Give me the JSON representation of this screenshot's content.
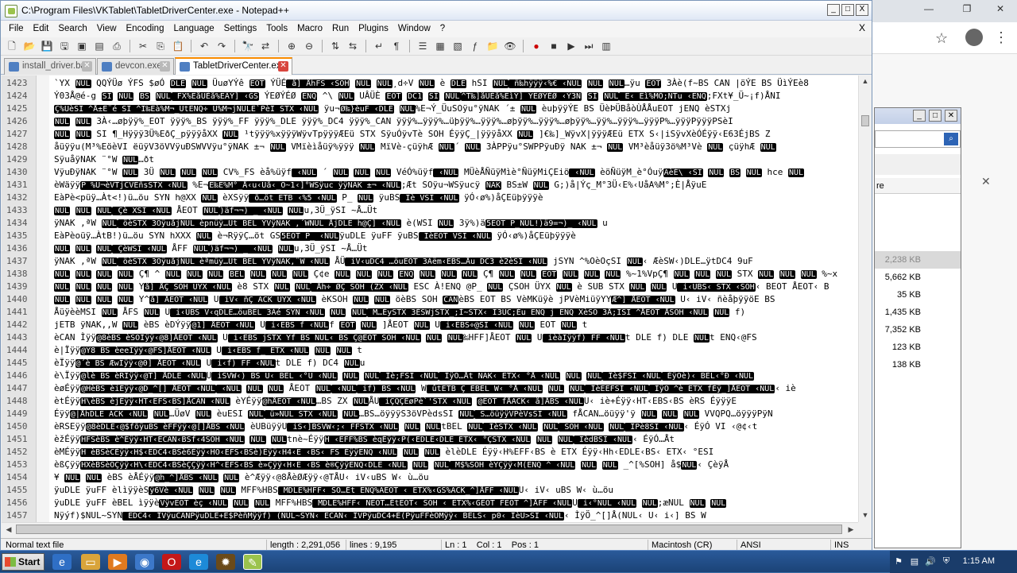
{
  "window": {
    "title": "C:\\Program Files\\VKTablet\\TabletDriverCenter.exe - Notepad++",
    "min_btn": "_",
    "max_btn": "□",
    "close_btn": "X"
  },
  "menubar": {
    "items": [
      "File",
      "Edit",
      "Search",
      "View",
      "Encoding",
      "Language",
      "Settings",
      "Tools",
      "Macro",
      "Run",
      "Plugins",
      "Window",
      "?"
    ],
    "close": "X"
  },
  "tabs": [
    {
      "label": "install_driver.bat",
      "active": false
    },
    {
      "label": "devcon.exe",
      "active": false
    },
    {
      "label": "TabletDriverCenter.exe",
      "active": true
    }
  ],
  "editor": {
    "lines": [
      {
        "num": "1423",
        "text": "`YX ‹NUL› QQÝÜø ÝFS $øÓ ‹DLE› ‹NUL› ÜuøYÝê ‹EOT› ÝÜÉ‹ å] ÅhFS ‹SOH› ‹NUL› ‹NUL›¸d÷V ‹NUL› è ‹DLE› hSI ‹NUL›‹ ñ‰hÿÿÿ‹%€ ‹NUL› ‹NUL› ‹NUL›…ÿu ‹EOT› 3Àè(f~BS CAN |öÝE BS ÜìÝEè8"
      },
      {
        "num": "1424",
        "text": "Ý03Å@é-g ‹SI› ‹NUL› ‹BS› ‹NUL›‹ FX%EåÜÈå%EÂÝ] ‹GS› ÝEØÝÉØ ‹ENQ› ^\\ ‹NUL› UÂÜÈ ‹EOT› ‹DC1› ‹SI› ‹NUL›‹^T‰]åÜÈå%EìÝ] ÝEØÝÉØ ‹Ý3N› ‹SI› ‹NUL›‹ E‹ Eì%MÕ;NTu ‹ENQ›;FXt¥_Ü~¡f)ÅNI"
      },
      {
        "num": "1425",
        "text": "‹Ç%ÜèSI ^Å±E¨é  SI ^I‰Eà%M¬_ÜtENQ÷ Ü%M¬jNULE`PèI STX ‹NUL› ÿu¬‹Ø‰}èuF ‹DLE› ‹NUL›%E¬Ý_ÜuSOÿu°ÿNAK ´± ‹NUL› èuþÿÿÝE BS ÜèÞÜBåòÙÅÅuEOT jENQ èSTXj"
      },
      {
        "num": "1426",
        "text": "‹NUL› ‹NUL› 3À‹…øþÿÿ%_EOT ÿÿÿ%_BS ÿÿÿ%_FF ÿÿÿ%_DLE ÿÿÿ%_DC4 ÿÿÿ%_CAN ÿÿÿ%…ÿÿÿ%…üþÿÿ%…ÿÿÿ%…øþÿÿ%…ÿÿÿ%…øþÿÿ%…ÿÿ%…ÿÿÿ%…ÿÿÿP%…ÿÿÿPÿÿÿPSèI"
      },
      {
        "num": "1427",
        "text": "‹NUL› ‹NUL› SI ¶_Hÿÿÿ3Ü%EðÇ_pÿÿÿåXX ‹NUL› ¹tÿÿÿ%xÿÿÿWÿvTpÿÿÿÆEü STX SÿuÓÿvTè SOH ÉÿÿÇ_|ÿÿÿåXX ‹NUL› ]€‰]_WÿvX|ÿÿÿÆEü ETX S‹|iSÿvXèÓÉÿÿ‹E63ÉjBS Z"
      },
      {
        "num": "1428",
        "text": "åüÿÿu(M³%EöèVI ëüÿV3öVVÿuÐSWVVÿu°ÿNAK ±¬ ‹NUL› VMïèìåüÿ%ÿÿÿ ‹NUL› MïVè-çüÿhÆ ‹NUL›´ ‹NUL› 3ÀPPÿu°SWPPÿuÐÿ NAK ±¬ ‹NUL› VM³èåüÿ3ö%M³Vè ‹NUL› çüÿhÆ ‹NUL›"
      },
      {
        "num": "1429",
        "text": "SÿuåÿNAK ¨°W ‹NUL›…ðt"
      },
      {
        "num": "1430",
        "text": "VÿuÐÿNAK ¨°W ‹NUL› 3Ü ‹NUL› ‹NUL› ‹NUL› CV%_FS èå%üÿf‹ ‹NUL› ´ ‹NUL› ‹NUL› ‹NUL› VéÓ%üÿf‹ ‹NUL› MÜèÅÑüÿMìè°ÑüÿMiÇEiö‹ ‹NUL› èöÑüÿM_è°Óuÿ‹ÃèÉ\\ ‹SI› ‹NUL› ‹BS› ‹NUL› hce ‹NUL›"
      },
      {
        "num": "1431",
        "text": "èWäÿÿ‹P %U¬èVTjCVËñsSTX ‹NUL› %E¬‹E‰E%M°_Å‹u‹Uå‹_Ò~1‹]°WSÿuc ÿÿNAK ±¬ ‹NUL›;Æt SOÿu¬WSÿucÿ ‹NAK› BS±W ‹NUL› G;)å|Ýç_M°3Ü‹E%‹UåA%M°;È|ÅÿuE"
      },
      {
        "num": "1432",
        "text": "EàPè<püÿ…Àt<!)ü…öu SYN h@XX ‹NUL› èXSÿÿ‹ õ…öt ETB ‹%5 ‹NUL› P_ ‹NUL› ÿuBS‹ Ïè VSI ‹NUL› ÿÓ‹ø%)åÇEüþÿÿÿè"
      },
      {
        "num": "1433",
        "text": "‹NUL› ‹NUL› ‹NUL›‹ Çè  XSI ‹NUL› ÅEOT ‹NUL›‹)äf¬¬) _ ‹NUL› ‹NUL›u,3Ü_ÿSI ~Å…Üt"
      },
      {
        "num": "1434",
        "text": "ÿNAK ,ªW ‹NUL›‹ öèSTX 3ÓÿuåjNUL èpnüÿ…Üt BEL ÝVÿNAK ,´WNUL ÅjDLE h@Ç] ‹NUL› è(WSI ‹NUL› 3ÿ%)ä‹5EOT P_NUL!)ä9=¬)_ ‹NUL› u"
      },
      {
        "num": "1435",
        "text": "EàPèoüÿ…ÀtB!)ü…öu SYN hXXX ‹NUL› è¬RÿÿÇ…öt GS‹5EOT P_ ‹NUL›ÿuDLE ÿuFF ÿuBS‹ ÏèEOT VSI ‹NUL› ÿÓ‹ø%)åÇEüþÿÿÿè"
      },
      {
        "num": "1436",
        "text": "‹NUL› ‹NUL› ‹NUL›‹ ÇèWSI ‹NUL› ÅFF ‹NUL›‹)äf¬¬) _ ‹NUL› ‹NUL›u,3Ü_ÿSI ~Å…Üt"
      },
      {
        "num": "1437",
        "text": "ÿNAK ,ªW ‹NUL›‹ öèSTX 3ÓÿuåjNUL èªmüÿ…Üt BEL ÝVÿNAK,¨W ‹NUL› ÅÜ‹ iV‹uDC4 …öuEOT 3Àëm‹EBS…Åu DC3 è2èSI ‹NUL› jSYN ^%OèOçSI ‹NUL›‹ ÆèSW‹)DLE…ÿtDC4 9uF"
      },
      {
        "num": "1438",
        "text": "‹NUL› ‹NUL› ‹NUL› ‹NUL› Ç¶ ^ ‹NUL› ‹NUL› ‹NUL› ‹BEL› ‹NUL› ‹NUL› ‹NUL› Ç¢e ‹NUL› ‹NUL› ‹NUL› ‹ENQ› ‹NUL› ‹NUL› ‹NUL› Ç¶ ‹NUL› ‹NUL› ‹EOT› ‹NUL› ‹NUL› ‹NUL› %~1%VpÇ¶ ‹NUL› ‹NUL› ‹NUL› STX ‹NUL› ‹NUL› ‹NUL› %~x"
      },
      {
        "num": "1439",
        "text": "‹NUL› ‹NUL› ‹NUL› ‹NUL› Y‹å] ÅÇ SOH ÜYX ‹NUL› è8 STX ‹NUL› ‹NUL›‹ Åh÷ ØÇ SOH (ZX ‹NUL› ESC À!ENQ @P_ ‹NUL› ÇSOH ÜYX ‹NUL› è SUB STX ‹NUL› ‹NUL› U‹ i‹UBS‹ STX ‹SOH›‹ BEOT ÅEOT‹ B"
      },
      {
        "num": "1440",
        "text": "‹NUL› ‹NUL› ‹NUL› ‹NUL› Y^‹å] ÅEOT ‹NUL› U‹ iV‹ ñÇ ACK ÜYX ‹NUL› èKSOH ‹NUL› ‹NUL› öèBS SOH ‹CAN›èBS EOT BS VèMKüÿè  jPVèMiüÿYY‹Æ^] ÅEOT ‹NUL› U‹ iV‹ ñèåþÿÿöE BS"
      },
      {
        "num": "1441",
        "text": "ÅüÿèèMSI ‹NUL› ÅFS ‹NUL› U‹ i‹UBS V‹qDLE…öuBEL 3Àé SYN ‹NUL› ‹NUL› ‹NUL›‹ M…ÉySTX 3ÉSWjSTX_;Ì~STX‹ Ï3ÜC;Éu ENQ j ENQ XèSO 3Å;ISI ^ÅEOT ÅSOH ‹NUL› ‹NUL› f)"
      },
      {
        "num": "1442",
        "text": "jETB ÿNAK,,W ‹NUL› èBS èDÝÿÿ‹@1] ÅEOT ‹NUL› U‹ i‹EBS f  ‹NUL›f ‹EOT› ‹NUL› ]ÅEOT ‹NUL› U‹ i‹EBS÷@SI ‹NUL› ‹NUL› EOT ‹NUL› t"
      },
      {
        "num": "1443",
        "text": "èCAN Ìÿÿ‹@8èBS èSOÌÿÿ‹@8]ÅEOT ‹NUL› U‹ i‹EBS jSTX Yf BS NUL‹ BS Ç@EOT SOH ‹NUL› ‹NUL› ‹NUL›‰HFF]ÅEOT ‹NUL› U‹ ièàÏÿÿf) FF ‹NUL›t DLE f) DLE ‹NUL›t ENQ‹@FS"
      },
      {
        "num": "1444",
        "text": "è|Ïÿÿ‹@Ý8 BS èeeÏÿÿ‹@FS]ÅEOT ‹NUL› U‹ i‹EBS f_ ETX ‹NUL› ‹NUL› ‹NUL› t"
      },
      {
        "num": "1445",
        "text": "èÏÿÿ‹@´è BS ÆwÎÿÿ‹@0] ÅEOT ‹NUL› U‹ i‹f) FF ‹NUL›t DLE f) DC4 ‹NUL›u"
      },
      {
        "num": "1446",
        "text": "è\\Ïÿÿ‹@lè BS èRÏÿÿ‹@T] ÅDLE ‹NUL›U‹ iSVW‹) BS U‹ BEL ‹°Ü ‹NUL› ‹NUL› ‹NUL›‹ Îè;FSI ‹NUL›‹ ÌÿÖ…Åt NAK‹ ETX‹ °Å ‹NUL› ‹NUL› ‹NUL›‹ Îè$FSI ‹NUL›‹ ÉÿÓè)‹ BEL‹°Ð ‹NUL›"
      },
      {
        "num": "1447",
        "text": "èøÉÿÿ‹@HèBS èiÉÿÿ‹@D_^[] ÅEOT ‹NUL›‹ ‹NUL› ‹NUL› ‹NUL› ÅEOT ‹NUL›‹ ‹NUL›‹ if) BS ‹NUL› W‹ ûtETB Ç EBEL W‹ °Å ‹NUL› ‹NUL› ‹NUL›‹ ÎèEEFSI ‹NUL›‹ ÌÿÖ ^è ETX fÈÿ_]ÅEOT ‹NUL›‹ iè"
      },
      {
        "num": "1448",
        "text": "ètÉÿÿ‹H\\èBS èjÉÿÿ‹HT‹EFS‹BS]ÅCAN ‹NUL› èYÉÿÿ‹@hÅEOT ‹NUL›…BS ZX ‹NUL›ÅU‹ iÇQÇÈøPè`'STX ‹NUL› ‹@EOT fÅACK‹ å]ÅBS ‹NUL›U‹ iè+Éÿÿ‹HT‹EBS‹BS èRS ÉÿÿÿE"
      },
      {
        "num": "1449",
        "text": "Éÿÿ‹@|ÅhDLE ACK ‹NUL› ‹NUL›…ÜøV ‹NUL› èuESI ‹NUL›‹ ü»NUL STX ‹NUL› ‹NUL›…BS…öÿÿÿS3öVPèdsSI ‹NUL›‹ S…öüÿÿVPèVsSI ‹NUL› fÅCAN…öüÿÿ'ÿ ‹NUL› ‹NUL› ‹NUL› VVQPQ…öÿÿÿPÿN"
      },
      {
        "num": "1450",
        "text": "èRSEÿÿ‹@8èDLE‹@$fõÿuBS èFFÿÿ‹@[]ÅBS ‹NUL› èUBüÿÿU‹ iS‹]BSVW‹;‹ FFSTX ‹NUL› ‹NUL› ‹NUL›tBEL ‹NUL›‹ ÍèSTX ‹NUL› ‹NUL›‹ SOH ‹NUL› ‹NUL›‹ ÎPè8SI ‹NUL›‹ ÉÿÓ VI ‹@¢‹t"
      },
      {
        "num": "1451",
        "text": "èžÉÿÿ‹HFSèBS è^Éÿÿ‹HT‹ECAN‹BSf‹4SOH ‹NUL› ‹NUL› ‹NUL›tnè~Éÿÿ‹H ‹EFF%BS èqÉÿÿ‹P(‹EDLE‹DLE ETX‹ °ÇSTX ‹NUL› ‹NUL› ‹NUL›‹ ÏèdBSI ‹NUL›‹ ÉÿÓ…Åt"
      },
      {
        "num": "1452",
        "text": "èMÉÿÿ‹H èBSèCÈÿÿ‹H$‹EDC4‹BSè6Èÿÿ‹HO‹EFS‹BSè)Èÿÿ‹H4‹E ‹BS‹ FS ÉÿÿENQ ‹NUL› ‹NUL› ‹NUL› èlèDLE Éÿÿ‹H%EFF‹BS è ETX Éÿÿ‹Hh‹EDLE‹BS‹ ETX‹ °ESI"
      },
      {
        "num": "1453",
        "text": "èßÇÿÿ‹HXèBSèÕÇÿÿ‹H\\‹EDC4‹BSèÇÇÿÿ‹H^‹EFS‹BS è»Çÿÿ‹H‹E ‹BS è®ÇÿÿENQ‹DLE ‹NUL› ‹NUL› ‹NUL›‹ M$%SOH èŸÇÿÿ‹M(ENQ ^ ‹NUL› ‹NUL› ‹NUL› _^[%SOH] å$‹NUL›‹ ÇèÿÅ"
      },
      {
        "num": "1454",
        "text": "¥ ‹NUL› ‹NUL› èBS èÅÉÿÿ‹@h_^]ÅBS ‹NUL› ‹NUL› è^Æÿÿ‹@8ÅèØÆÿÿ‹@TÅU‹ iV‹uBS W‹ ù…öu"
      },
      {
        "num": "1455",
        "text": "ÿuDLE ÿuFF èlìÿÿèS‹ÿ6Vè ‹NUL› ‹NUL› ‹NUL› MFF%HBS‹ MDLE%HFF‹ SO…Ét ENQ%AEOT ‹ ETX%‹GS%ACK_^]ÅFF ‹NUL›U‹ iV‹ uBS W‹ ù…öu"
      },
      {
        "num": "1456",
        "text": "ÿuDLE ÿuFF èBEL ìÿÿè‹VÿvEOT èç ‹NUL› ‹NUL› ‹NUL› MFF%HBS‹ MDLE%HFF‹ NEOT…ÉtEOT‹ SOH ‹ ETX%‹GEOT FEOT ^]ÅFF ‹NUL›U‹ i‹°NUL ‹NUL› ‹NUL›;æNUL ‹NUL› ‹NUL›"
      },
      {
        "num": "1457",
        "text": "Nÿýf)$NUL~SYN‹ EDC4‹ ÎVÿuCANPÿuDLE+E$PèñMÿÿf) (NUL~SYN‹ ECAN‹ ÎVPÿuDC4+E(PÿuFFèÕMÿÿ‹ BELS‹ p0‹ ÎèÜ>SI ‹NUL›‹ ÌÿÖ_^[]Å(NUL‹ U‹ i‹] BS W"
      }
    ]
  },
  "statusbar": {
    "file_type": "Normal text file",
    "length": "length : 2,291,056",
    "lines": "lines : 9,195",
    "position": "Ln : 1    Col : 1    Pos : 1",
    "eol": "Macintosh (CR)",
    "encoding": "ANSI",
    "mode": "INS"
  },
  "side_window": {
    "column_partial": "re",
    "sizes": [
      "2,238 KB",
      "5,662 KB",
      "35 KB",
      "1,435 KB",
      "7,352 KB",
      "123 KB",
      "138 KB"
    ]
  },
  "taskbar": {
    "start_label": "Start",
    "clock": "1:15 AM"
  },
  "colors": {
    "title_gradient": "#dfe8f5",
    "active_tab_accent": "#fa8c00",
    "taskbar": "#1b4377"
  }
}
